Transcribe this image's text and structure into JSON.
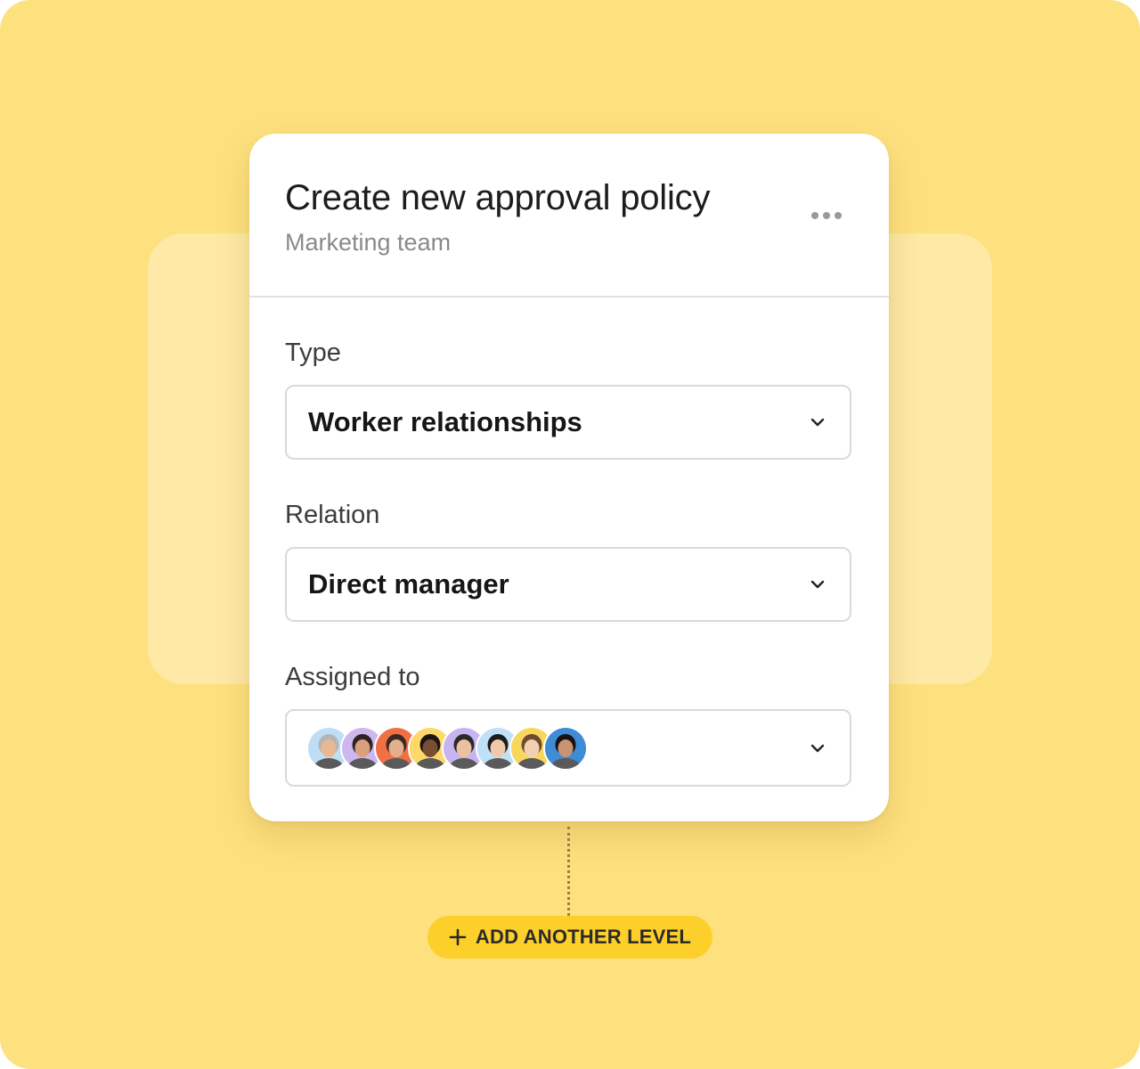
{
  "policy": {
    "title": "Create new approval policy",
    "subtitle": "Marketing team",
    "menu_icon": "more-horizontal-icon"
  },
  "fields": {
    "type": {
      "label": "Type",
      "value": "Worker relationships"
    },
    "relation": {
      "label": "Relation",
      "value": "Direct manager"
    },
    "assigned": {
      "label": "Assigned to",
      "avatars": [
        {
          "bg": "#BFDDF4",
          "skin": "#E8B894",
          "hair": "#B5B5B5"
        },
        {
          "bg": "#CDB7EE",
          "skin": "#D9A07E",
          "hair": "#2E2320"
        },
        {
          "bg": "#F07043",
          "skin": "#E4B08C",
          "hair": "#3A2A20"
        },
        {
          "bg": "#FFD86A",
          "skin": "#7A4E35",
          "hair": "#1E1610"
        },
        {
          "bg": "#C8B4F0",
          "skin": "#EBC1A0",
          "hair": "#2A2A2A"
        },
        {
          "bg": "#BFE0F6",
          "skin": "#F0C9AA",
          "hair": "#1B1B1B"
        },
        {
          "bg": "#F8D75E",
          "skin": "#F3CFB4",
          "hair": "#6E4A2E"
        },
        {
          "bg": "#3E8BD6",
          "skin": "#C99474",
          "hair": "#181210"
        }
      ]
    }
  },
  "actions": {
    "add_level_label": "ADD ANOTHER LEVEL"
  },
  "colors": {
    "background": "#FEE17F",
    "button": "#FDCF2B"
  }
}
